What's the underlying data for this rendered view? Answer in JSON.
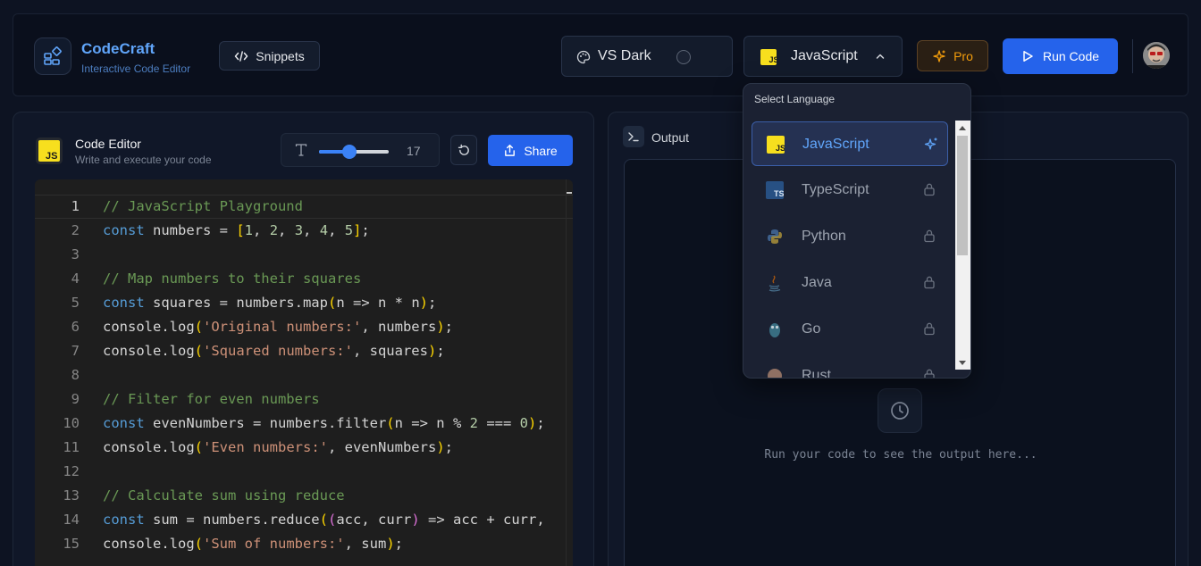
{
  "header": {
    "brand_title": "CodeCraft",
    "brand_subtitle": "Interactive Code Editor",
    "snippets_label": "Snippets",
    "theme_label": "VS Dark",
    "language_label": "JavaScript",
    "pro_label": "Pro",
    "run_label": "Run Code"
  },
  "editor": {
    "badge": "JS",
    "title": "Code Editor",
    "subtitle": "Write and execute your code",
    "font_size": "17",
    "font_size_fraction": 0.44,
    "share_label": "Share",
    "lines": [
      {
        "n": "1",
        "html": "<span class=\"cm\">// JavaScript Playground</span>"
      },
      {
        "n": "2",
        "html": "<span class=\"kw\">const</span> numbers = <span class=\"b1\">[</span><span class=\"nm\">1</span>, <span class=\"nm\">2</span>, <span class=\"nm\">3</span>, <span class=\"nm\">4</span>, <span class=\"nm\">5</span><span class=\"b1\">]</span>;"
      },
      {
        "n": "3",
        "html": ""
      },
      {
        "n": "4",
        "html": "<span class=\"cm\">// Map numbers to their squares</span>"
      },
      {
        "n": "5",
        "html": "<span class=\"kw\">const</span> squares = numbers.map<span class=\"b1\">(</span>n =&gt; n * n<span class=\"b1\">)</span>;"
      },
      {
        "n": "6",
        "html": "console.log<span class=\"b1\">(</span><span class=\"st\">'Original numbers:'</span>, numbers<span class=\"b1\">)</span>;"
      },
      {
        "n": "7",
        "html": "console.log<span class=\"b1\">(</span><span class=\"st\">'Squared numbers:'</span>, squares<span class=\"b1\">)</span>;"
      },
      {
        "n": "8",
        "html": ""
      },
      {
        "n": "9",
        "html": "<span class=\"cm\">// Filter for even numbers</span>"
      },
      {
        "n": "10",
        "html": "<span class=\"kw\">const</span> evenNumbers = numbers.filter<span class=\"b1\">(</span>n =&gt; n % <span class=\"nm\">2</span> === <span class=\"nm\">0</span><span class=\"b1\">)</span>;"
      },
      {
        "n": "11",
        "html": "console.log<span class=\"b1\">(</span><span class=\"st\">'Even numbers:'</span>, evenNumbers<span class=\"b1\">)</span>;"
      },
      {
        "n": "12",
        "html": ""
      },
      {
        "n": "13",
        "html": "<span class=\"cm\">// Calculate sum using reduce</span>"
      },
      {
        "n": "14",
        "html": "<span class=\"kw\">const</span> sum = numbers.reduce<span class=\"b1\">(</span><span class=\"b2\">(</span>acc, curr<span class=\"b2\">)</span> =&gt; acc + curr,"
      },
      {
        "n": "15",
        "html": "console.log<span class=\"b1\">(</span><span class=\"st\">'Sum of numbers:'</span>, sum<span class=\"b1\">)</span>;"
      }
    ]
  },
  "output": {
    "title": "Output",
    "placeholder": "Run your code to see the output here..."
  },
  "dropdown": {
    "heading": "Select Language",
    "items": [
      {
        "label": "JavaScript",
        "icon": "javascript-icon",
        "state": "selected"
      },
      {
        "label": "TypeScript",
        "icon": "typescript-icon",
        "state": "locked"
      },
      {
        "label": "Python",
        "icon": "python-icon",
        "state": "locked"
      },
      {
        "label": "Java",
        "icon": "java-icon",
        "state": "locked"
      },
      {
        "label": "Go",
        "icon": "go-icon",
        "state": "locked"
      },
      {
        "label": "Rust",
        "icon": "rust-icon",
        "state": "locked"
      }
    ]
  },
  "colors": {
    "accent": "#2563eb",
    "brand": "#60a5fa",
    "pro": "#f59e0b",
    "js_yellow": "#f7df1e"
  }
}
